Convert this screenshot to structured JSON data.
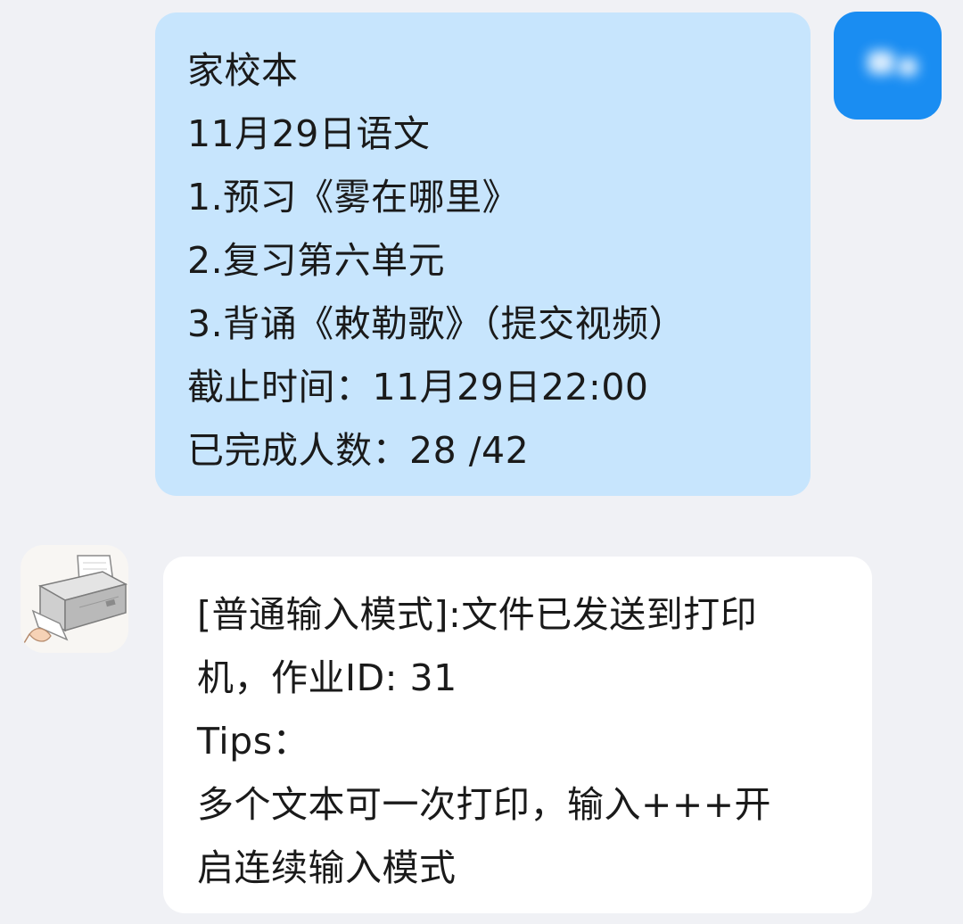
{
  "chat": {
    "sent_message": {
      "lines": [
        "家校本",
        "11月29日语文",
        "1.预习《雾在哪里》",
        "2.复习第六单元",
        "3.背诵《敕勒歌》（提交视频）",
        "截止时间：11月29日22:00",
        "已完成人数：28 /42"
      ],
      "bubble_color": "#c7e5fd"
    },
    "self_avatar": {
      "icon": "blurred-user-avatar",
      "color": "#1a8df2"
    },
    "received_message": {
      "lines": [
        "[普通输入模式]:文件已发送到打印",
        "机，作业ID: 31",
        "Tips：",
        "多个文本可一次打印，输入+++开",
        "启连续输入模式"
      ],
      "bubble_color": "#ffffff"
    },
    "bot_avatar": {
      "icon": "printer-icon"
    }
  }
}
